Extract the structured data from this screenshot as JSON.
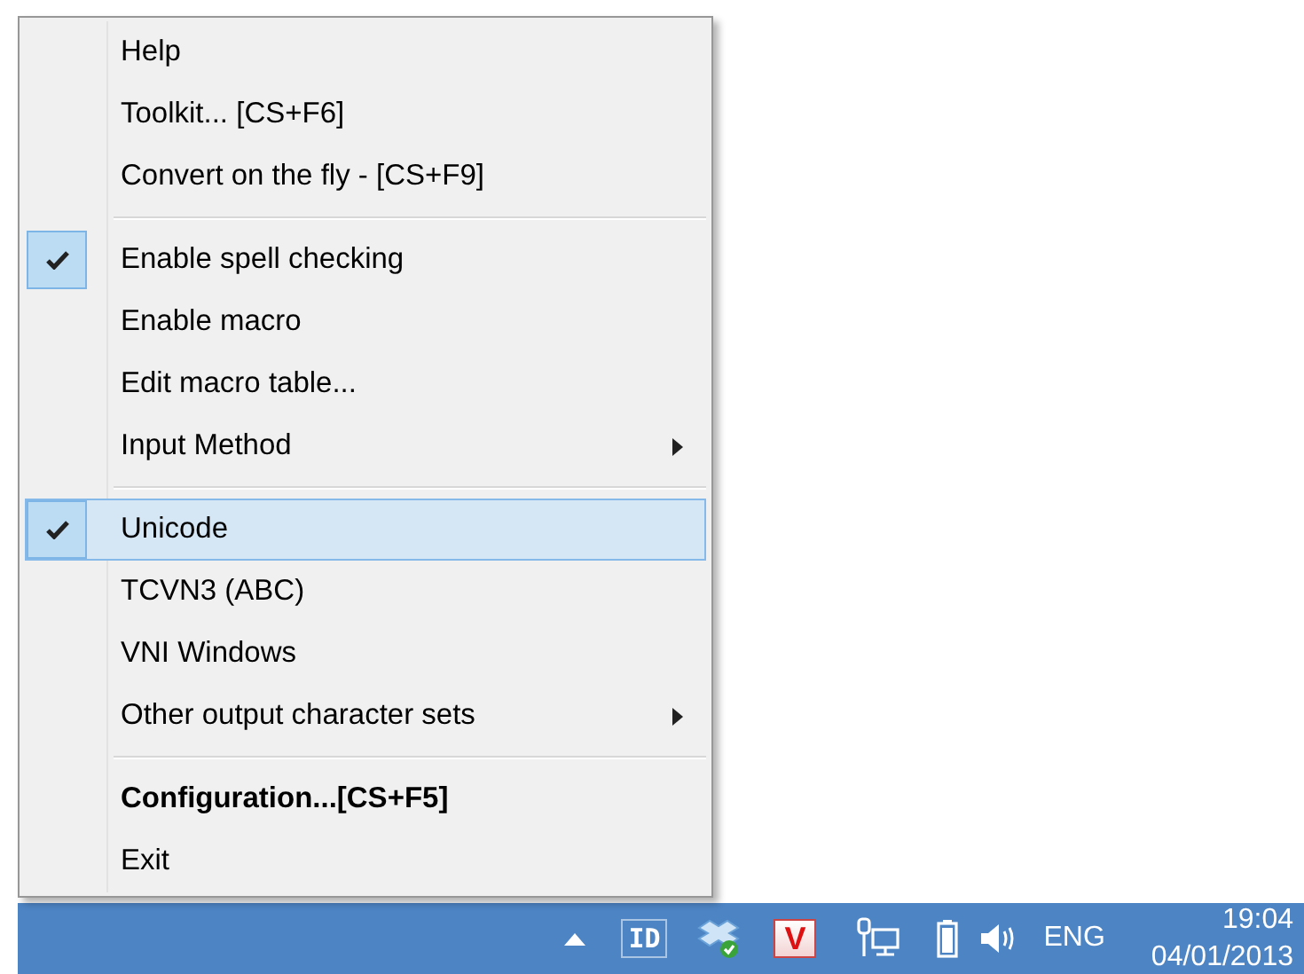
{
  "menu": {
    "items": [
      {
        "kind": "item",
        "label": "Help",
        "checked": false,
        "selected": false,
        "submenu": false,
        "default": false
      },
      {
        "kind": "item",
        "label": "Toolkit... [CS+F6]",
        "checked": false,
        "selected": false,
        "submenu": false,
        "default": false
      },
      {
        "kind": "item",
        "label": "Convert on the fly - [CS+F9]",
        "checked": false,
        "selected": false,
        "submenu": false,
        "default": false
      },
      {
        "kind": "separator"
      },
      {
        "kind": "item",
        "label": "Enable spell checking",
        "checked": true,
        "selected": false,
        "submenu": false,
        "default": false
      },
      {
        "kind": "item",
        "label": "Enable macro",
        "checked": false,
        "selected": false,
        "submenu": false,
        "default": false
      },
      {
        "kind": "item",
        "label": "Edit macro table...",
        "checked": false,
        "selected": false,
        "submenu": false,
        "default": false
      },
      {
        "kind": "item",
        "label": "Input Method",
        "checked": false,
        "selected": false,
        "submenu": true,
        "default": false
      },
      {
        "kind": "separator"
      },
      {
        "kind": "item",
        "label": "Unicode",
        "checked": true,
        "selected": true,
        "submenu": false,
        "default": false
      },
      {
        "kind": "item",
        "label": "TCVN3 (ABC)",
        "checked": false,
        "selected": false,
        "submenu": false,
        "default": false
      },
      {
        "kind": "item",
        "label": "VNI Windows",
        "checked": false,
        "selected": false,
        "submenu": false,
        "default": false
      },
      {
        "kind": "item",
        "label": "Other output character sets",
        "checked": false,
        "selected": false,
        "submenu": true,
        "default": false
      },
      {
        "kind": "separator"
      },
      {
        "kind": "item",
        "label": "Configuration...[CS+F5]",
        "checked": false,
        "selected": false,
        "submenu": false,
        "default": true
      },
      {
        "kind": "item",
        "label": "Exit",
        "checked": false,
        "selected": false,
        "submenu": false,
        "default": false
      }
    ]
  },
  "taskbar": {
    "tray": [
      {
        "kind": "arrow"
      },
      {
        "kind": "text-icon",
        "label": "ID"
      },
      {
        "kind": "box"
      },
      {
        "kind": "logo",
        "label": "V"
      },
      {
        "kind": "network"
      },
      {
        "kind": "battery"
      },
      {
        "kind": "volume"
      }
    ],
    "language": "ENG",
    "time": "19:04",
    "date": "04/01/2013"
  }
}
